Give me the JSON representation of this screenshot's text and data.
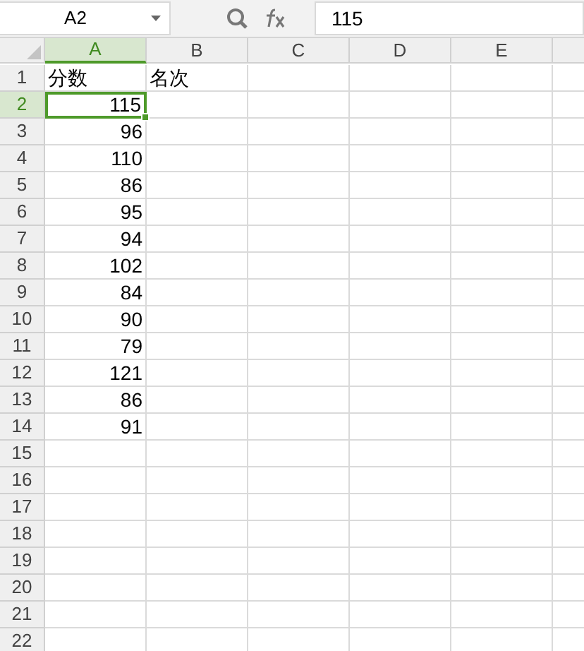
{
  "name_box": "A2",
  "formula": "115",
  "columns": [
    {
      "label": "A",
      "selected": true
    },
    {
      "label": "B",
      "selected": false
    },
    {
      "label": "C",
      "selected": false
    },
    {
      "label": "D",
      "selected": false
    },
    {
      "label": "E",
      "selected": false
    }
  ],
  "rows": [
    {
      "label": "1",
      "selected": false,
      "cells": [
        {
          "value": "分数",
          "kind": "text",
          "selected": false
        },
        {
          "value": "名次",
          "kind": "text",
          "selected": false
        }
      ]
    },
    {
      "label": "2",
      "selected": true,
      "cells": [
        {
          "value": "115",
          "kind": "number",
          "selected": true
        }
      ]
    },
    {
      "label": "3",
      "selected": false,
      "cells": [
        {
          "value": "96",
          "kind": "number",
          "selected": false
        }
      ]
    },
    {
      "label": "4",
      "selected": false,
      "cells": [
        {
          "value": "110",
          "kind": "number",
          "selected": false
        }
      ]
    },
    {
      "label": "5",
      "selected": false,
      "cells": [
        {
          "value": "86",
          "kind": "number",
          "selected": false
        }
      ]
    },
    {
      "label": "6",
      "selected": false,
      "cells": [
        {
          "value": "95",
          "kind": "number",
          "selected": false
        }
      ]
    },
    {
      "label": "7",
      "selected": false,
      "cells": [
        {
          "value": "94",
          "kind": "number",
          "selected": false
        }
      ]
    },
    {
      "label": "8",
      "selected": false,
      "cells": [
        {
          "value": "102",
          "kind": "number",
          "selected": false
        }
      ]
    },
    {
      "label": "9",
      "selected": false,
      "cells": [
        {
          "value": "84",
          "kind": "number",
          "selected": false
        }
      ]
    },
    {
      "label": "10",
      "selected": false,
      "cells": [
        {
          "value": "90",
          "kind": "number",
          "selected": false
        }
      ]
    },
    {
      "label": "11",
      "selected": false,
      "cells": [
        {
          "value": "79",
          "kind": "number",
          "selected": false
        }
      ]
    },
    {
      "label": "12",
      "selected": false,
      "cells": [
        {
          "value": "121",
          "kind": "number",
          "selected": false
        }
      ]
    },
    {
      "label": "13",
      "selected": false,
      "cells": [
        {
          "value": "86",
          "kind": "number",
          "selected": false
        }
      ]
    },
    {
      "label": "14",
      "selected": false,
      "cells": [
        {
          "value": "91",
          "kind": "number",
          "selected": false
        }
      ]
    },
    {
      "label": "15",
      "selected": false
    },
    {
      "label": "16",
      "selected": false
    },
    {
      "label": "17",
      "selected": false
    },
    {
      "label": "18",
      "selected": false
    },
    {
      "label": "19",
      "selected": false
    },
    {
      "label": "20",
      "selected": false
    },
    {
      "label": "21",
      "selected": false
    },
    {
      "label": "22",
      "selected": false
    }
  ]
}
